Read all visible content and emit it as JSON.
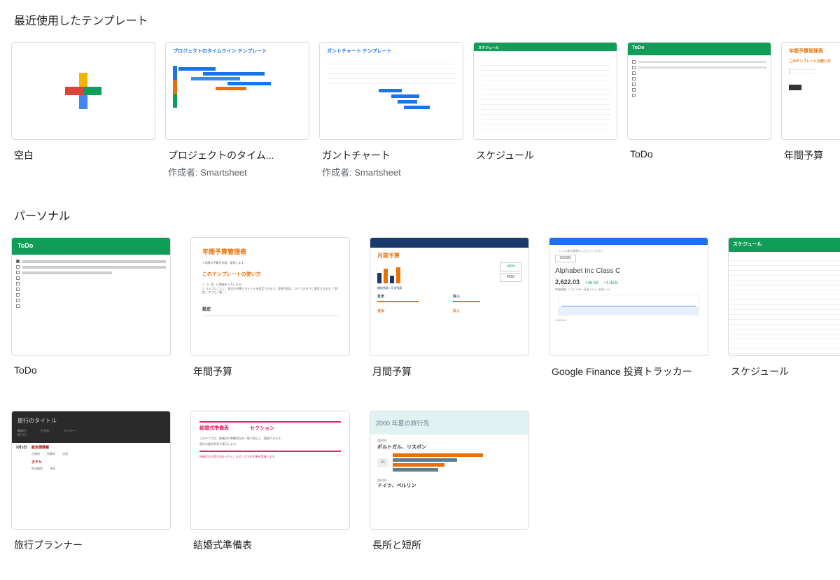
{
  "sections": {
    "recent": {
      "title": "最近使用したテンプレート",
      "items": [
        {
          "title": "空白",
          "sub": ""
        },
        {
          "title": "プロジェクトのタイム...",
          "sub": "作成者: Smartsheet"
        },
        {
          "title": "ガントチャート",
          "sub": "作成者: Smartsheet"
        },
        {
          "title": "スケジュール",
          "sub": ""
        },
        {
          "title": "ToDo",
          "sub": ""
        },
        {
          "title": "年間予算",
          "sub": ""
        }
      ]
    },
    "personal": {
      "title": "パーソナル",
      "items_row1": [
        {
          "title": "ToDo"
        },
        {
          "title": "年間予算"
        },
        {
          "title": "月間予算"
        },
        {
          "title": "Google Finance 投資トラッカー"
        },
        {
          "title": "スケジュール"
        }
      ],
      "items_row2": [
        {
          "title": "旅行プランナー"
        },
        {
          "title": "結婚式準備表"
        },
        {
          "title": "長所と短所"
        }
      ]
    }
  },
  "previews": {
    "project_timeline_title": "プロジェクトのタイムライン テンプレート",
    "gantt_title": "ガントチャート テンプレート",
    "todo_label": "ToDo",
    "annual_budget_title": "年間予算管理表",
    "annual_budget_sub": "このテンプレートの使い方",
    "monthly_budget_title": "月間予算",
    "stock_name": "Alphabet Inc Class C",
    "stock_price": "2,622.03",
    "stock_change1": "+36.59",
    "stock_change2": "+1.42%",
    "travel_title": "旅行のタイトル",
    "wedding_title": "結婚式準備表",
    "wedding_section": "セクション",
    "pros_title": "2000 年夏の旅行先",
    "pros_item1": "ポルトガル、リスボン",
    "pros_item2": "ドイツ、ベルリン",
    "schedule_head": "スケジュール"
  }
}
